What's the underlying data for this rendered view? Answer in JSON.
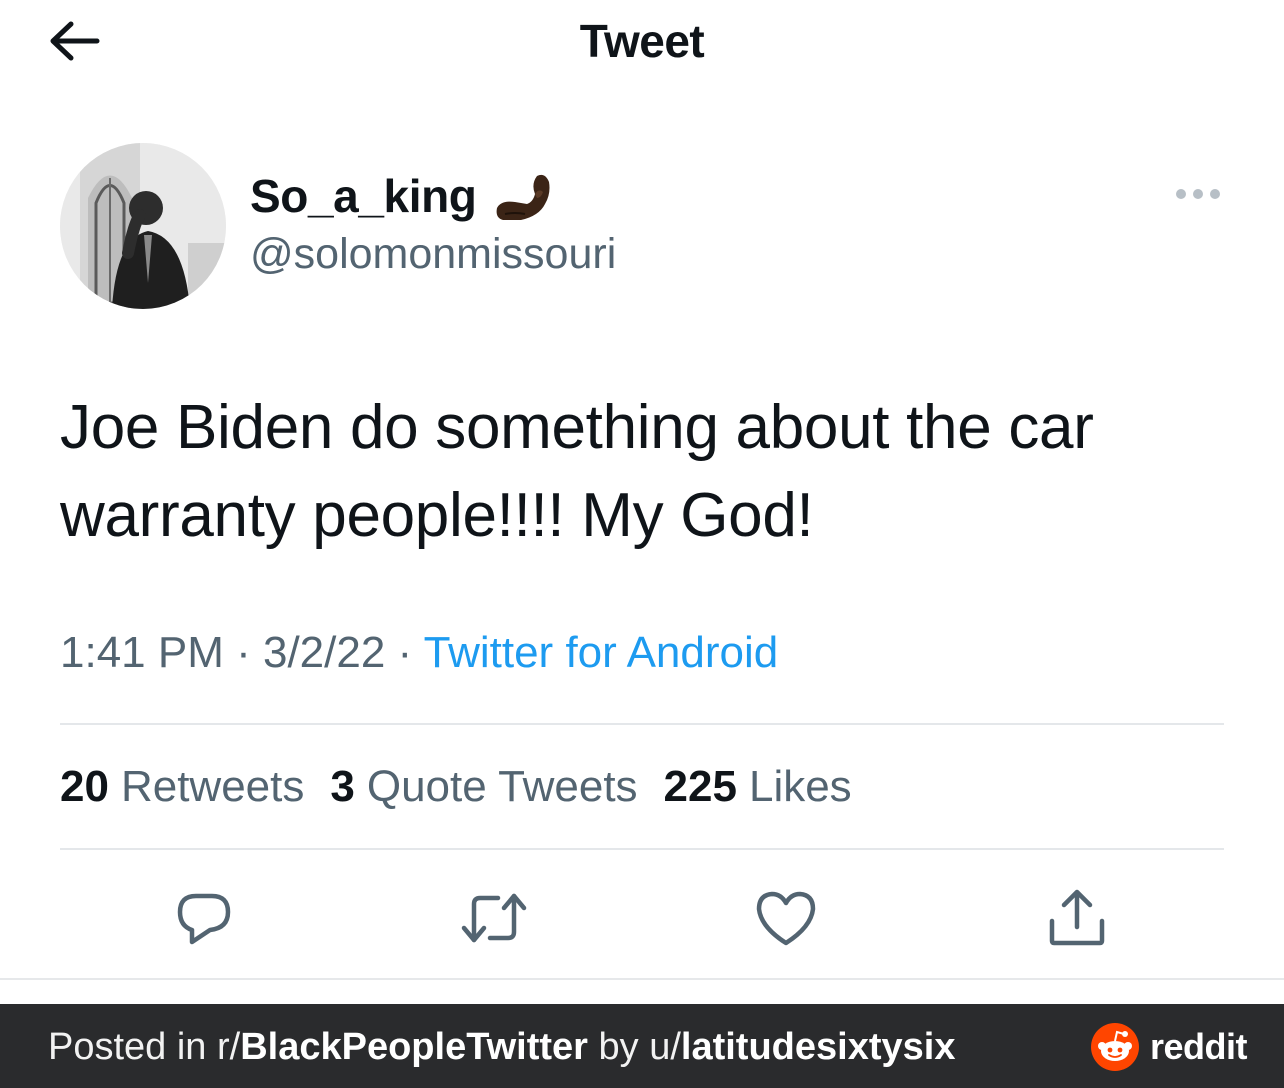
{
  "header": {
    "title": "Tweet"
  },
  "author": {
    "display_name": "So_a_king",
    "name_emoji": "pinched-fingers-emoji",
    "handle": "@solomonmissouri"
  },
  "tweet": {
    "text": "Joe Biden do something about the car warranty people!!!! My God!"
  },
  "meta": {
    "time": "1:41 PM",
    "sep1": " · ",
    "date": "3/2/22",
    "sep2": " · ",
    "source": "Twitter for Android"
  },
  "stats": {
    "retweets_count": "20",
    "retweets_label": "Retweets",
    "quotes_count": "3",
    "quotes_label": "Quote Tweets",
    "likes_count": "225",
    "likes_label": "Likes"
  },
  "actions": {
    "icons": [
      "reply-icon",
      "retweet-icon",
      "like-icon",
      "share-icon"
    ]
  },
  "reddit_bar": {
    "posted_prefix": "Posted in r/",
    "subreddit": "BlackPeopleTwitter",
    "by_text": " by u/",
    "username": "latitudesixtysix",
    "brand": "reddit"
  },
  "colors": {
    "link_blue": "#1d9bf0",
    "secondary_text": "#536471",
    "primary_text": "#0f1419",
    "reddit_orange": "#ff4500",
    "reddit_bar_bg": "#2a2b2d"
  }
}
